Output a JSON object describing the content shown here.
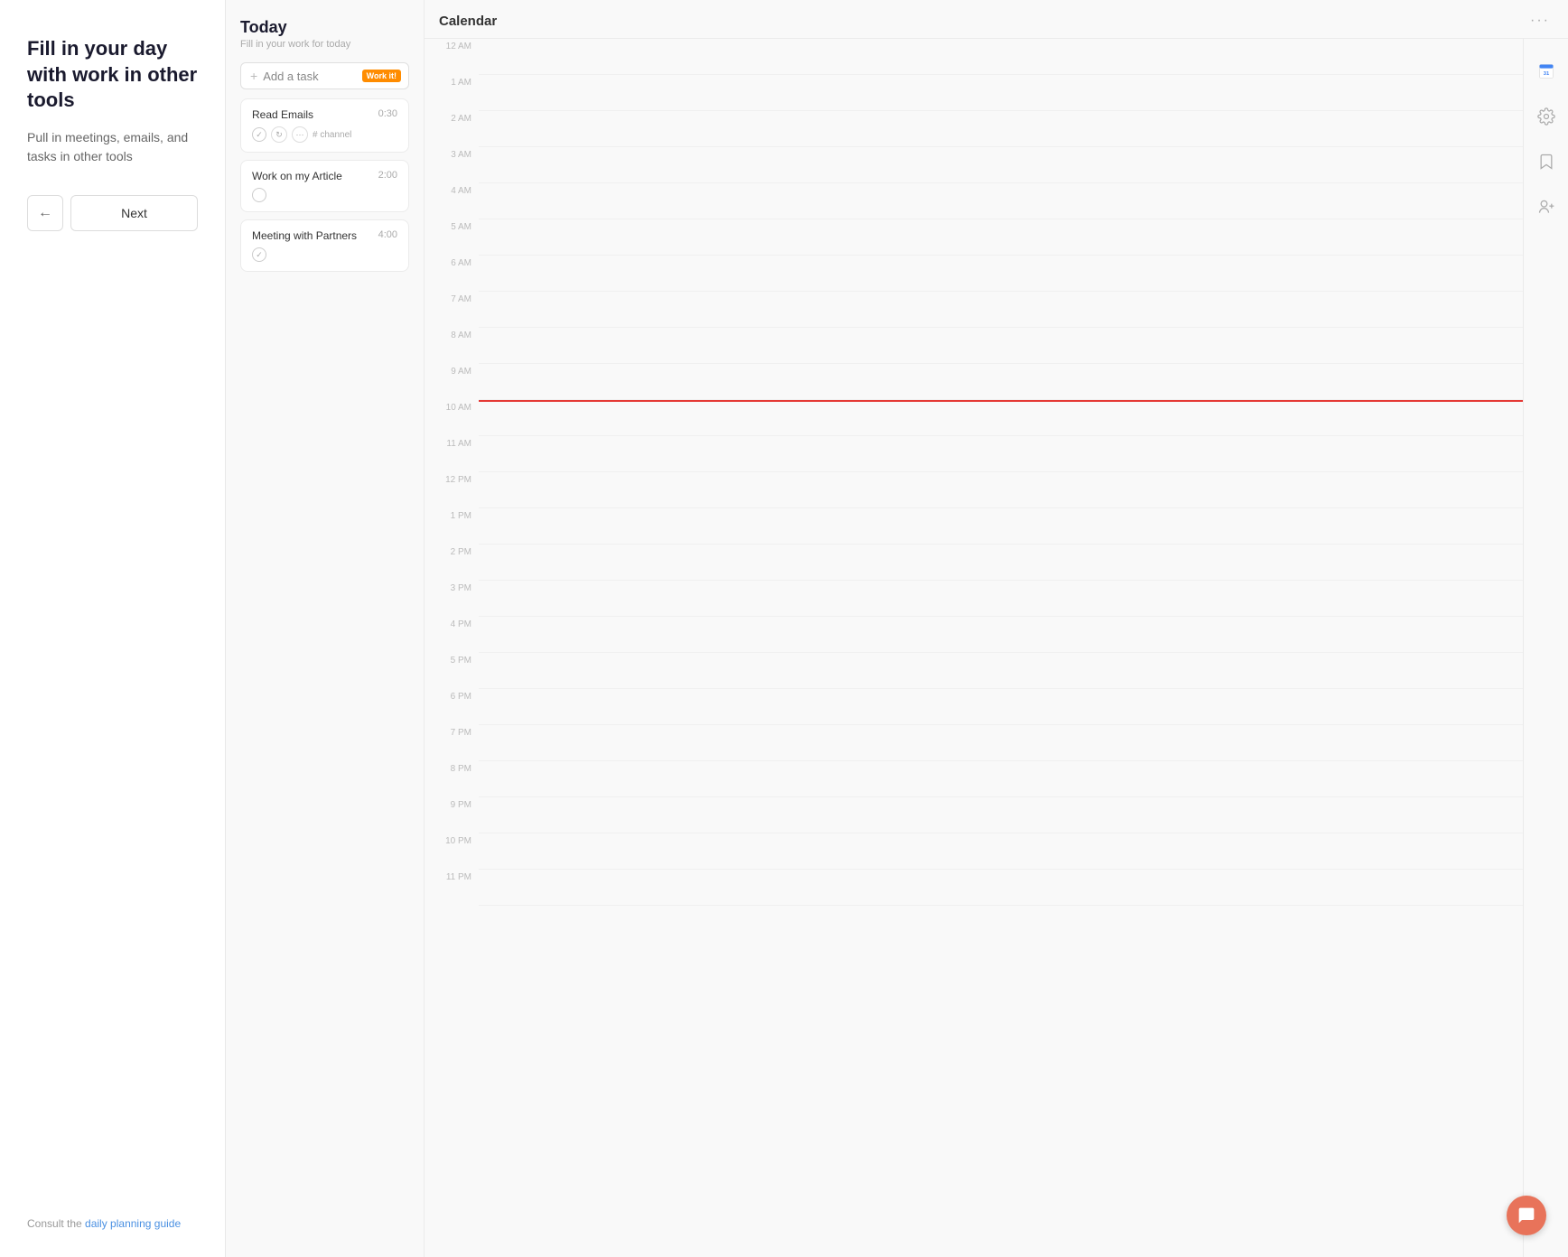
{
  "left": {
    "title": "Fill in your day with work in other tools",
    "subtitle": "Pull in meetings, emails, and tasks in other tools",
    "btn_back_label": "←",
    "btn_next_label": "Next",
    "footer_text": "Consult the ",
    "footer_link_text": "daily planning guide"
  },
  "today": {
    "title": "Today",
    "subtitle": "Fill in your work for today",
    "add_task_placeholder": "Add a task",
    "workit_badge": "Work it!",
    "tasks": [
      {
        "name": "Read Emails",
        "duration": "0:30",
        "channel": "# channel",
        "has_actions": true,
        "checked": false
      },
      {
        "name": "Work on my Article",
        "duration": "2:00",
        "checked": false
      },
      {
        "name": "Meeting with Partners",
        "duration": "4:00",
        "checked": false
      }
    ]
  },
  "calendar": {
    "title": "Calendar",
    "more_btn": "···",
    "time_slots": [
      "12 AM",
      "1 AM",
      "2 AM",
      "3 AM",
      "4 AM",
      "5 AM",
      "6 AM",
      "7 AM",
      "8 AM",
      "9 AM",
      "10 AM",
      "11 AM",
      "12 PM",
      "1 PM",
      "2 PM",
      "3 PM",
      "4 PM",
      "5 PM",
      "6 PM",
      "7 PM",
      "8 PM",
      "9 PM",
      "10 PM",
      "11 PM"
    ]
  },
  "sidebar_icons": [
    {
      "name": "google-calendar-icon",
      "color": "#4285F4"
    },
    {
      "name": "settings-icon",
      "color": "#888"
    },
    {
      "name": "bookmark-icon",
      "color": "#888"
    },
    {
      "name": "google-plus-icon",
      "color": "#888"
    }
  ]
}
